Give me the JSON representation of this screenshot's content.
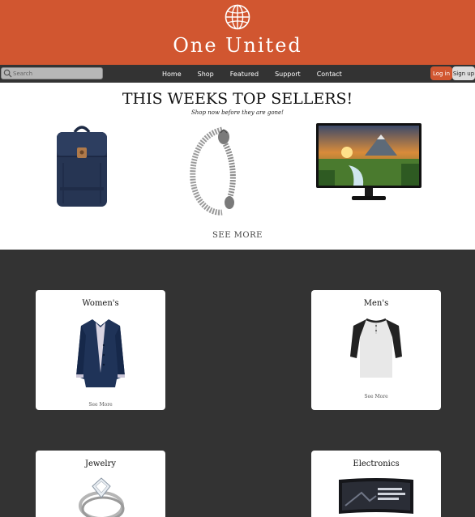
{
  "header": {
    "brand": "One United",
    "logo_icon": "globe-icon"
  },
  "nav": {
    "search_placeholder": "Search",
    "links": [
      "Home",
      "Shop",
      "Featured",
      "Support",
      "Contact"
    ],
    "login_label": "Log in",
    "signup_label": "Sign up"
  },
  "top_sellers": {
    "title": "THIS WEEKS TOP SELLERS!",
    "subtitle": "Shop now before they are gone!",
    "products": [
      "backpack",
      "silver-bracelet",
      "computer-monitor"
    ],
    "see_more": "SEE MORE"
  },
  "categories": [
    {
      "title": "Women's",
      "image": "womens-jacket",
      "see_more": "See More"
    },
    {
      "title": "Men's",
      "image": "mens-raglan-shirt",
      "see_more": "See More"
    },
    {
      "title": "Jewelry",
      "image": "diamond-ring"
    },
    {
      "title": "Electronics",
      "image": "curved-monitor"
    }
  ],
  "colors": {
    "accent": "#d15630",
    "dark": "#333333",
    "white": "#ffffff"
  }
}
